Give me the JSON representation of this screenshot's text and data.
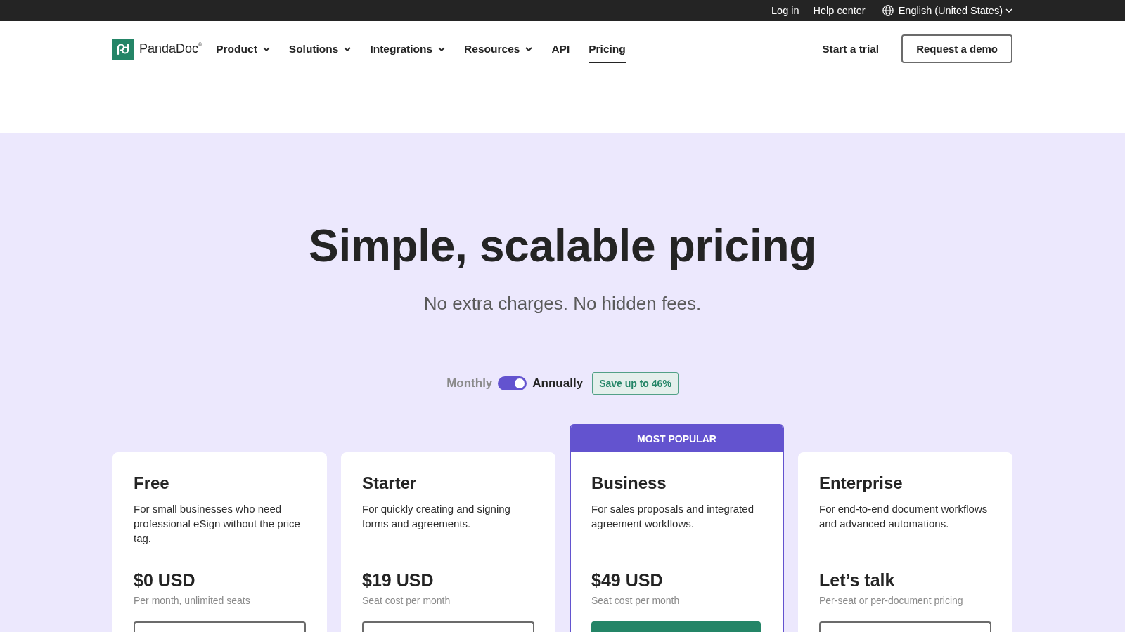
{
  "top_bar": {
    "links": [
      "Log in",
      "Help center"
    ],
    "language": "English (United States)"
  },
  "header": {
    "logo": "PandaDoc$^{®}$",
    "nav": [
      {
        "label": "Product",
        "dropdown": true,
        "selected": false
      },
      {
        "label": "Solutions",
        "dropdown": true,
        "selected": false
      },
      {
        "label": "Integrations",
        "dropdown": true,
        "selected": false
      },
      {
        "label": "Resources",
        "dropdown": true,
        "selected": false
      },
      {
        "label": "API",
        "dropdown": false,
        "selected": false
      },
      {
        "label": "Pricing",
        "dropdown": false,
        "selected": true
      }
    ],
    "trial_link": "Start a trial",
    "demo_button": "Request a demo"
  },
  "hero": {
    "title": "Simple, scalable pricing",
    "subtitle": "No extra charges. No hidden fees."
  },
  "billing": {
    "left_label": "Monthly",
    "right_label": "Annually",
    "annual": true,
    "savings_badge": "Save up to 46%"
  },
  "plans": [
    {
      "name": "Free",
      "description": "For small businesses who need professional eSign without the price tag.",
      "price": "$0 USD",
      "price_note": "Per month, unlimited seats",
      "highlighted": false,
      "cta": {
        "kind": "outline"
      }
    },
    {
      "name": "Starter",
      "description": "For quickly creating and signing forms and agreements.",
      "price": "$19 USD",
      "price_note": "Seat cost per month",
      "highlighted": false,
      "cta": {
        "kind": "outline"
      }
    },
    {
      "name": "Business",
      "banner": "MOST POPULAR",
      "description": "For sales proposals and integrated agreement workflows.",
      "price": "$49 USD",
      "price_note": "Seat cost per month",
      "highlighted": true,
      "cta": {
        "kind": "filled"
      }
    },
    {
      "name": "Enterprise",
      "description": "For end-to-end document workflows and advanced automations.",
      "price": "Let’s talk",
      "price_note": "Per-seat or per-document pricing",
      "highlighted": false,
      "cta": {
        "kind": "outline"
      }
    }
  ]
}
